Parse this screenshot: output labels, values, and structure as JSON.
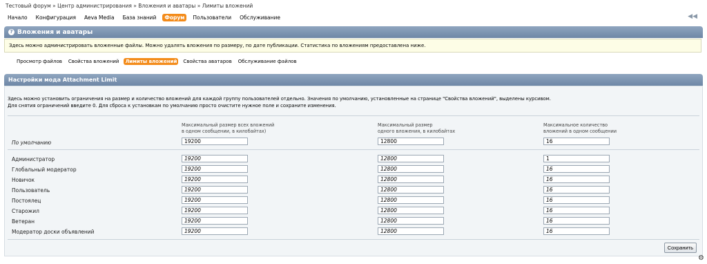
{
  "breadcrumb": [
    "Тестовый форум",
    "Центр администрирования",
    "Вложения и аватары",
    "Лимиты вложений"
  ],
  "breadcrumb_sep": "»",
  "topmenu": [
    {
      "label": "Начало",
      "active": false
    },
    {
      "label": "Конфигурация",
      "active": false
    },
    {
      "label": "Aeva Media",
      "active": false
    },
    {
      "label": "База знаний",
      "active": false
    },
    {
      "label": "Форум",
      "active": true
    },
    {
      "label": "Пользователи",
      "active": false
    },
    {
      "label": "Обслуживание",
      "active": false
    }
  ],
  "section": {
    "title": "Вложения и аватары",
    "info": "Здесь можно администрировать вложенные файлы. Можно удалять вложения по размеру, по дате публикации. Статистика по вложениям предоставлена ниже."
  },
  "subtabs": [
    {
      "label": "Просмотр файлов",
      "active": false
    },
    {
      "label": "Свойства вложений",
      "active": false
    },
    {
      "label": "Лимиты вложений",
      "active": true
    },
    {
      "label": "Свойства аватаров",
      "active": false
    },
    {
      "label": "Обслуживание файлов",
      "active": false
    }
  ],
  "panel": {
    "title": "Настройки мода Attachment Limit",
    "desc_line1": "Здесь можно установить ограничения на размер и количество вложений для каждой группу пользователей отдельно. Значения по умолчанию, установленные на странице \"Свойства вложений\", выделены курсивом.",
    "desc_line2": "Для снятия ограничений введите 0. Для сброса к установкам по умолчанию просто очистите нужное поле и сохраните изменения.",
    "columns": [
      {
        "line1": "Максимальный размер всех вложений",
        "line2": "в одном сообщении, в килобайтах)"
      },
      {
        "line1": "Максимальный размер",
        "line2": "одного вложения, в килобайтах"
      },
      {
        "line1": "Максимальное количество",
        "line2": "вложений в одном сообщении"
      }
    ],
    "default_row": {
      "label": "По умолчанию",
      "v1": "19200",
      "v2": "12800",
      "v3": "16"
    },
    "rows": [
      {
        "label": "Администратор",
        "v1": "19200",
        "v2": "12800",
        "v3": "1"
      },
      {
        "label": "Глобальный модератор",
        "v1": "19200",
        "v2": "12800",
        "v3": "16"
      },
      {
        "label": "Новичок",
        "v1": "19200",
        "v2": "12800",
        "v3": "16"
      },
      {
        "label": "Пользователь",
        "v1": "19200",
        "v2": "12800",
        "v3": "16"
      },
      {
        "label": "Постоялец",
        "v1": "19200",
        "v2": "12800",
        "v3": "16"
      },
      {
        "label": "Старожил",
        "v1": "19200",
        "v2": "12800",
        "v3": "16"
      },
      {
        "label": "Ветеран",
        "v1": "19200",
        "v2": "12800",
        "v3": "16"
      },
      {
        "label": "Модератор доски объявлений",
        "v1": "19200",
        "v2": "12800",
        "v3": "16"
      }
    ],
    "save_label": "Сохранить"
  },
  "icons": {
    "collapse": "double-left-arrow-icon",
    "help": "help-icon",
    "corner": "gear-icon"
  },
  "colors": {
    "accent": "#f38b1a",
    "titlebar": "#7b93b0",
    "infobox_bg": "#fdfde6"
  }
}
